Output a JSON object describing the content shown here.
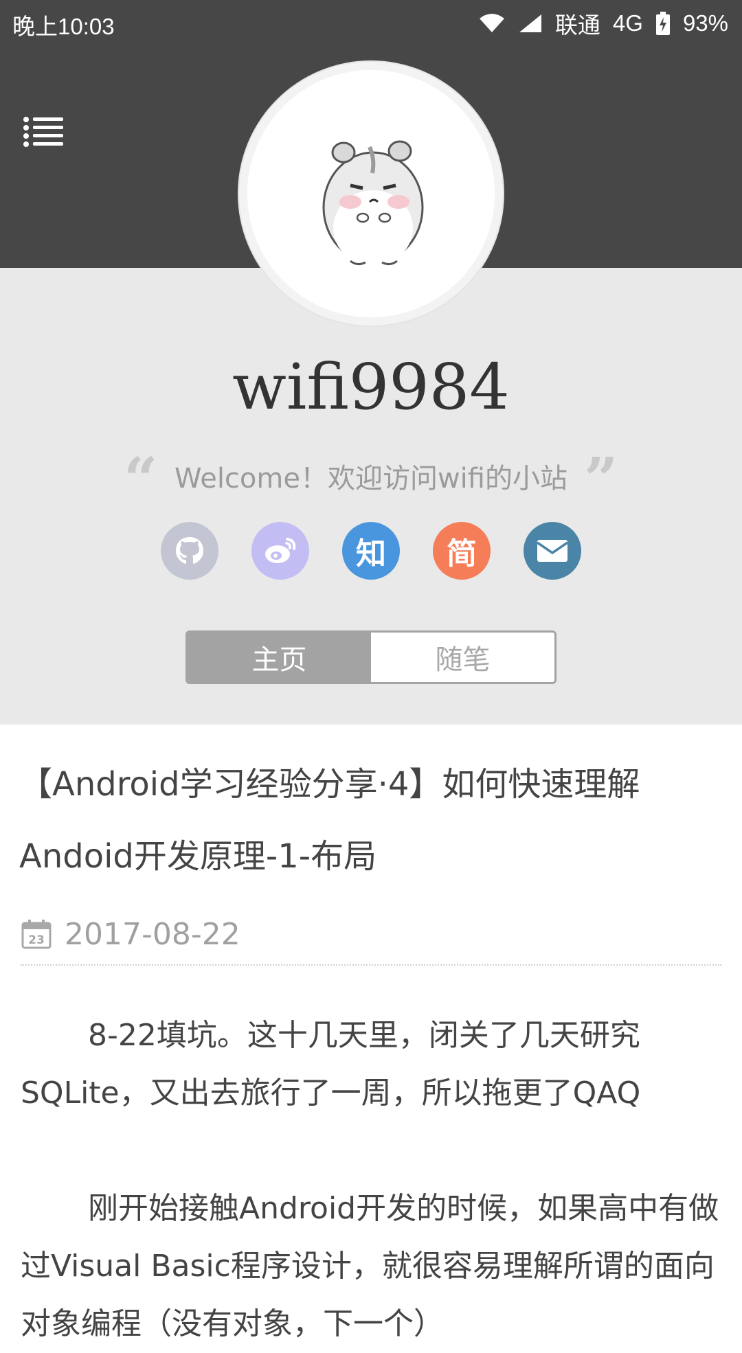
{
  "status_bar": {
    "time": "晚上10:03",
    "carrier": "联通",
    "network": "4G",
    "battery": "93%",
    "icons": [
      "wifi-icon",
      "signal-icon",
      "battery-icon"
    ]
  },
  "header": {
    "menu_icon": "list-menu-icon",
    "avatar_icon": "hamster-avatar"
  },
  "profile": {
    "name": "wifi9984",
    "welcome": "Welcome！欢迎访问wifi的小站",
    "social": [
      {
        "name": "github",
        "glyph": "",
        "color": "#c3c6d2"
      },
      {
        "name": "weibo",
        "glyph": "",
        "color": "#c2bdf2"
      },
      {
        "name": "zhihu",
        "glyph": "知",
        "color": "#4a96de"
      },
      {
        "name": "jianshu",
        "glyph": "简",
        "color": "#f57d58"
      },
      {
        "name": "email",
        "glyph": "",
        "color": "#4a84a6"
      }
    ],
    "tabs": [
      {
        "label": "主页",
        "active": true
      },
      {
        "label": "随笔",
        "active": false
      }
    ]
  },
  "post": {
    "title_line1": "【Android学习经验分享·4】如何快速理解",
    "title_line2": "Andoid开发原理-1-布局",
    "date": "2017-08-22",
    "calendar_day": "23",
    "paragraphs": [
      "8-22填坑。这十几天里，闭关了几天研究SQLite，又出去旅行了一周，所以拖更了QAQ",
      "刚开始接触Android开发的时候，如果高中有做过Visual Basic程序设计，就很容易理解所谓的面向对象编程（没有对象，下一个）"
    ]
  },
  "colors": {
    "header_bg": "#474747",
    "profile_bg": "#e9e9e9",
    "tab_active": "#a3a3a3"
  }
}
